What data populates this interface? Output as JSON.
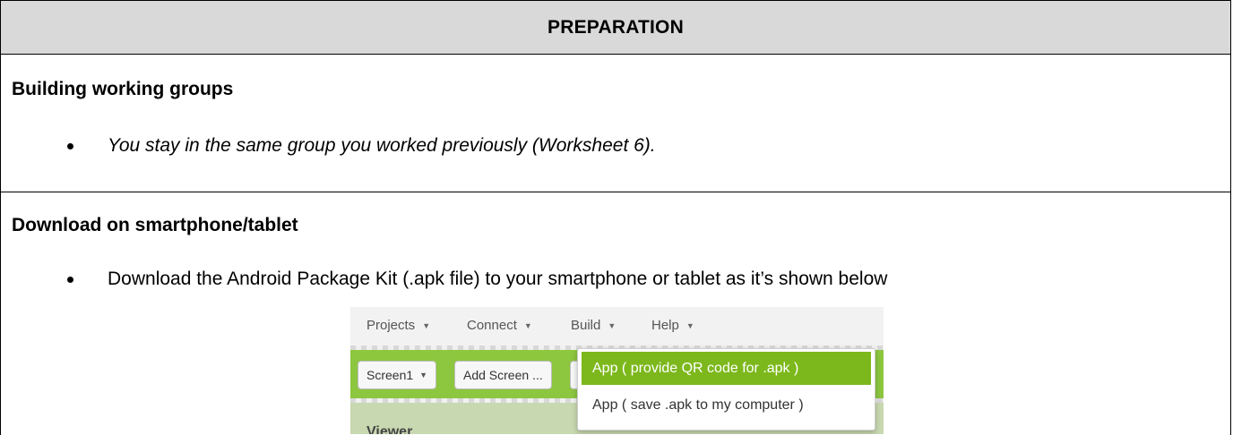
{
  "header": {
    "title": "PREPARATION"
  },
  "section1": {
    "heading": "Building working groups",
    "bullet": "You stay in the same group you worked previously (Worksheet 6)."
  },
  "section2": {
    "heading": "Download on smartphone/tablet",
    "bullet": "Download the Android Package Kit (.apk file) to your smartphone or tablet as it’s shown below"
  },
  "screenshot": {
    "menu": [
      "Projects",
      "Connect",
      "Build",
      "Help"
    ],
    "screen_button": "Screen1",
    "add_screen_button": "Add Screen ...",
    "viewer_label": "Viewer",
    "build_menu_items": [
      "App ( provide QR code for .apk )",
      "App ( save .apk to my computer )"
    ],
    "colors": {
      "toolbar_green": "#8dc63f",
      "highlight_green": "#7cb81b"
    }
  }
}
